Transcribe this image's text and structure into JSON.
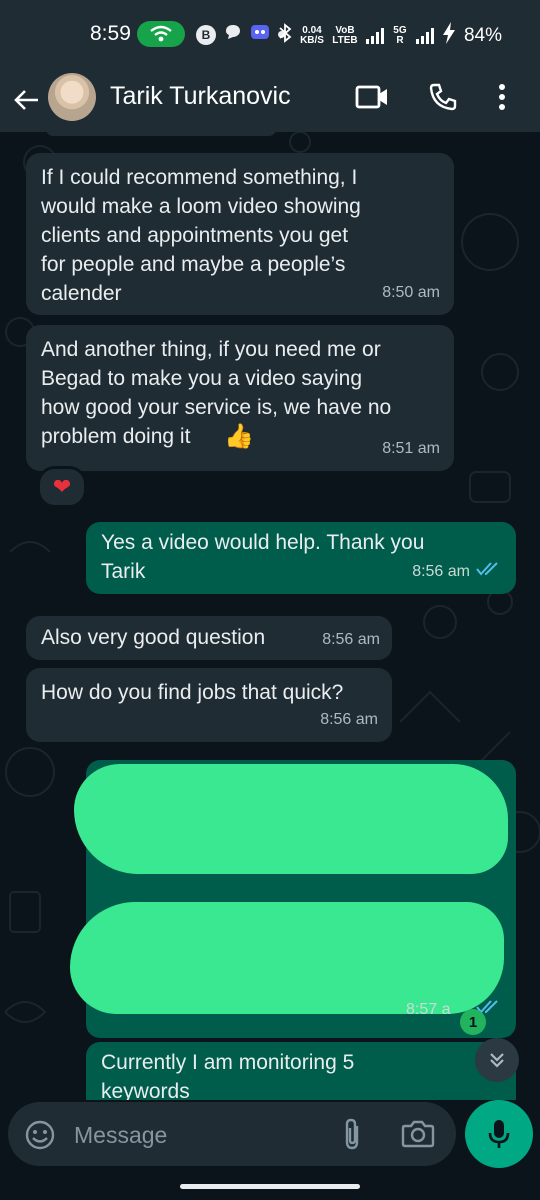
{
  "status_bar": {
    "time": "8:59",
    "speed_value": "0.04",
    "speed_unit": "KB/S",
    "network_1": "VoB LTEB",
    "network_2": "5G R",
    "battery": "84%",
    "icons": [
      "wifi-icon",
      "b-icon",
      "chat-bubble-icon",
      "discord-icon",
      "bluetooth-icon",
      "signal-icon",
      "charging-icon"
    ]
  },
  "header": {
    "contact_name": "Tarik Turkanovic",
    "icons": [
      "back-arrow-icon",
      "avatar",
      "video-call-icon",
      "phone-icon",
      "more-vert-icon"
    ]
  },
  "messages": [
    {
      "direction": "incoming",
      "text": "If I could recommend something, I\nwould make a loom video showing\nclients and appointments you get\nfor people and maybe a people’s\ncalender",
      "time": "8:50 am"
    },
    {
      "direction": "incoming",
      "text": "And another thing, if you need me or\nBegad to make you a video saying\nhow good your service is, we have no\nproblem doing it",
      "emoji": "👍",
      "time": "8:51 am",
      "reaction": "❤"
    },
    {
      "direction": "outgoing",
      "text": "Yes a video would help. Thank you\nTarik",
      "time": "8:56 am",
      "status": "read"
    },
    {
      "direction": "incoming",
      "text": "Also very good question",
      "time": "8:56 am"
    },
    {
      "direction": "incoming",
      "text": "How do you find jobs that quick?",
      "time": "8:56 am"
    },
    {
      "direction": "outgoing",
      "text": "",
      "redacted": true,
      "time": "8:57 a",
      "status": "read"
    },
    {
      "direction": "outgoing",
      "text": "Currently I am monitoring 5\nkeywords",
      "partially_visible": true
    }
  ],
  "unread_count": "1",
  "composer": {
    "placeholder": "Message",
    "icons": [
      "emoji-icon",
      "attach-icon",
      "camera-icon",
      "mic-icon",
      "chevron-double-down-icon"
    ]
  },
  "colors": {
    "incoming_bubble": "#202c33",
    "outgoing_bubble": "#005c4b",
    "accent": "#00a884",
    "redaction": "#3be892"
  }
}
